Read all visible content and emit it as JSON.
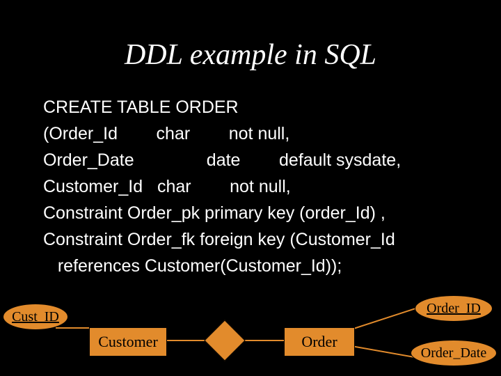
{
  "title": "DDL example in SQL",
  "code_lines": [
    "CREATE TABLE ORDER",
    "(Order_Id        char        not null,",
    "Order_Date               date        default sysdate,",
    "Customer_Id   char        not null,",
    "Constraint Order_pk primary key (order_Id) ,",
    "Constraint Order_fk foreign key (Customer_Id",
    "   references Customer(Customer_Id));"
  ],
  "diagram": {
    "cust_id": "Cust_ID",
    "customer": "Customer",
    "order": "Order",
    "order_id": "Order_ID",
    "order_date": "Order_Date"
  },
  "colors": {
    "bg": "#000000",
    "text": "#ffffff",
    "shape": "#e28b2c"
  }
}
